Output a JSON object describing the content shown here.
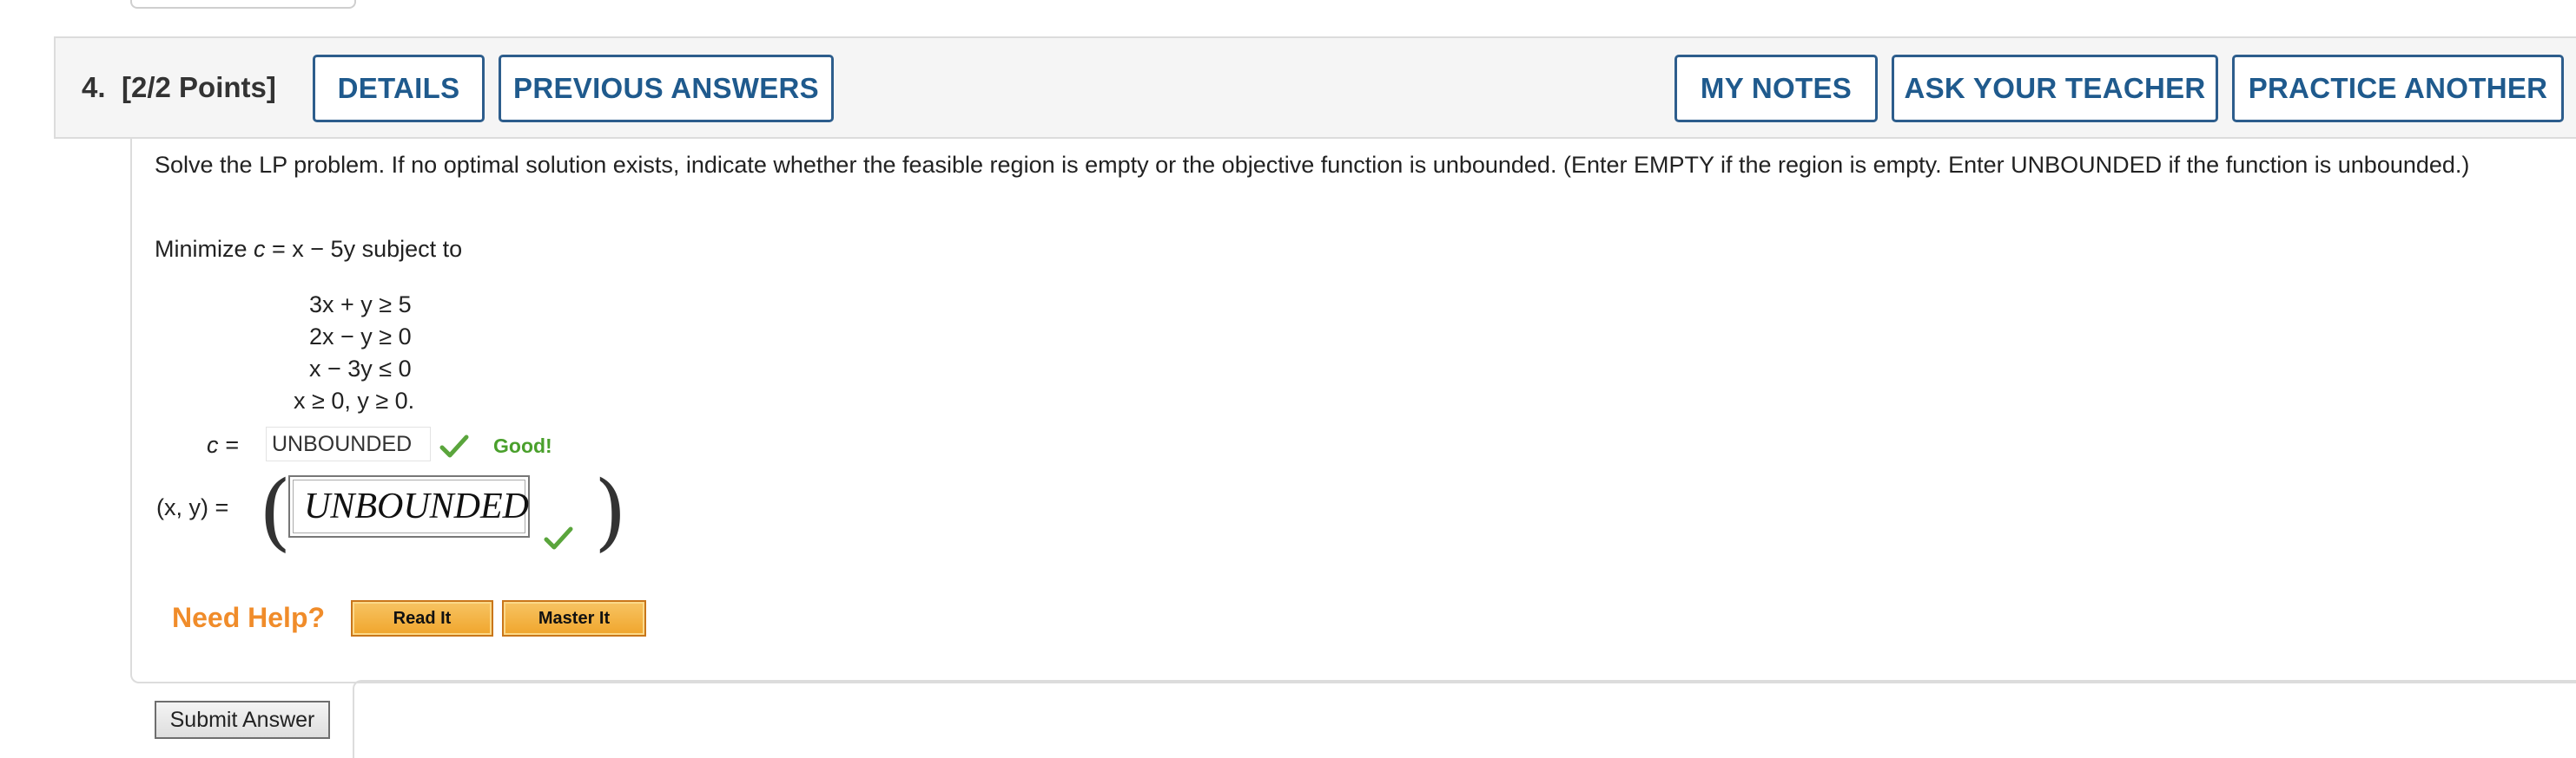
{
  "question": {
    "number": "4.",
    "points": "[2/2 Points]"
  },
  "header_buttons": {
    "details": "DETAILS",
    "previous_answers": "PREVIOUS ANSWERS",
    "my_notes": "MY NOTES",
    "ask_teacher": "ASK YOUR TEACHER",
    "practice_another": "PRACTICE ANOTHER"
  },
  "prompt": "Solve the LP problem. If no optimal solution exists, indicate whether the feasible region is empty or the objective function is unbounded. (Enter EMPTY if the region is empty. Enter UNBOUNDED if the function is unbounded.)",
  "objective": {
    "prefix": "Minimize ",
    "var": "c",
    "expr": " = x − 5y",
    "suffix": " subject to"
  },
  "constraints": [
    "3x + y ≥ 5",
    "2x − y ≥ 0",
    "x − 3y ≤ 0",
    "x ≥ 0, y ≥ 0."
  ],
  "answer_c": {
    "label": "c  =",
    "value": "UNBOUNDED",
    "feedback": "Good!"
  },
  "answer_xy": {
    "label": "(x, y)  =",
    "value": "UNBOUNDED"
  },
  "help": {
    "label": "Need Help?",
    "read_it": "Read It",
    "master_it": "Master It"
  },
  "submit": {
    "label": "Submit Answer"
  },
  "colors": {
    "button_text": "#1f5a8d",
    "button_border": "#2d5d8c",
    "good_green": "#4aa02c",
    "help_orange": "#f08c2a"
  }
}
